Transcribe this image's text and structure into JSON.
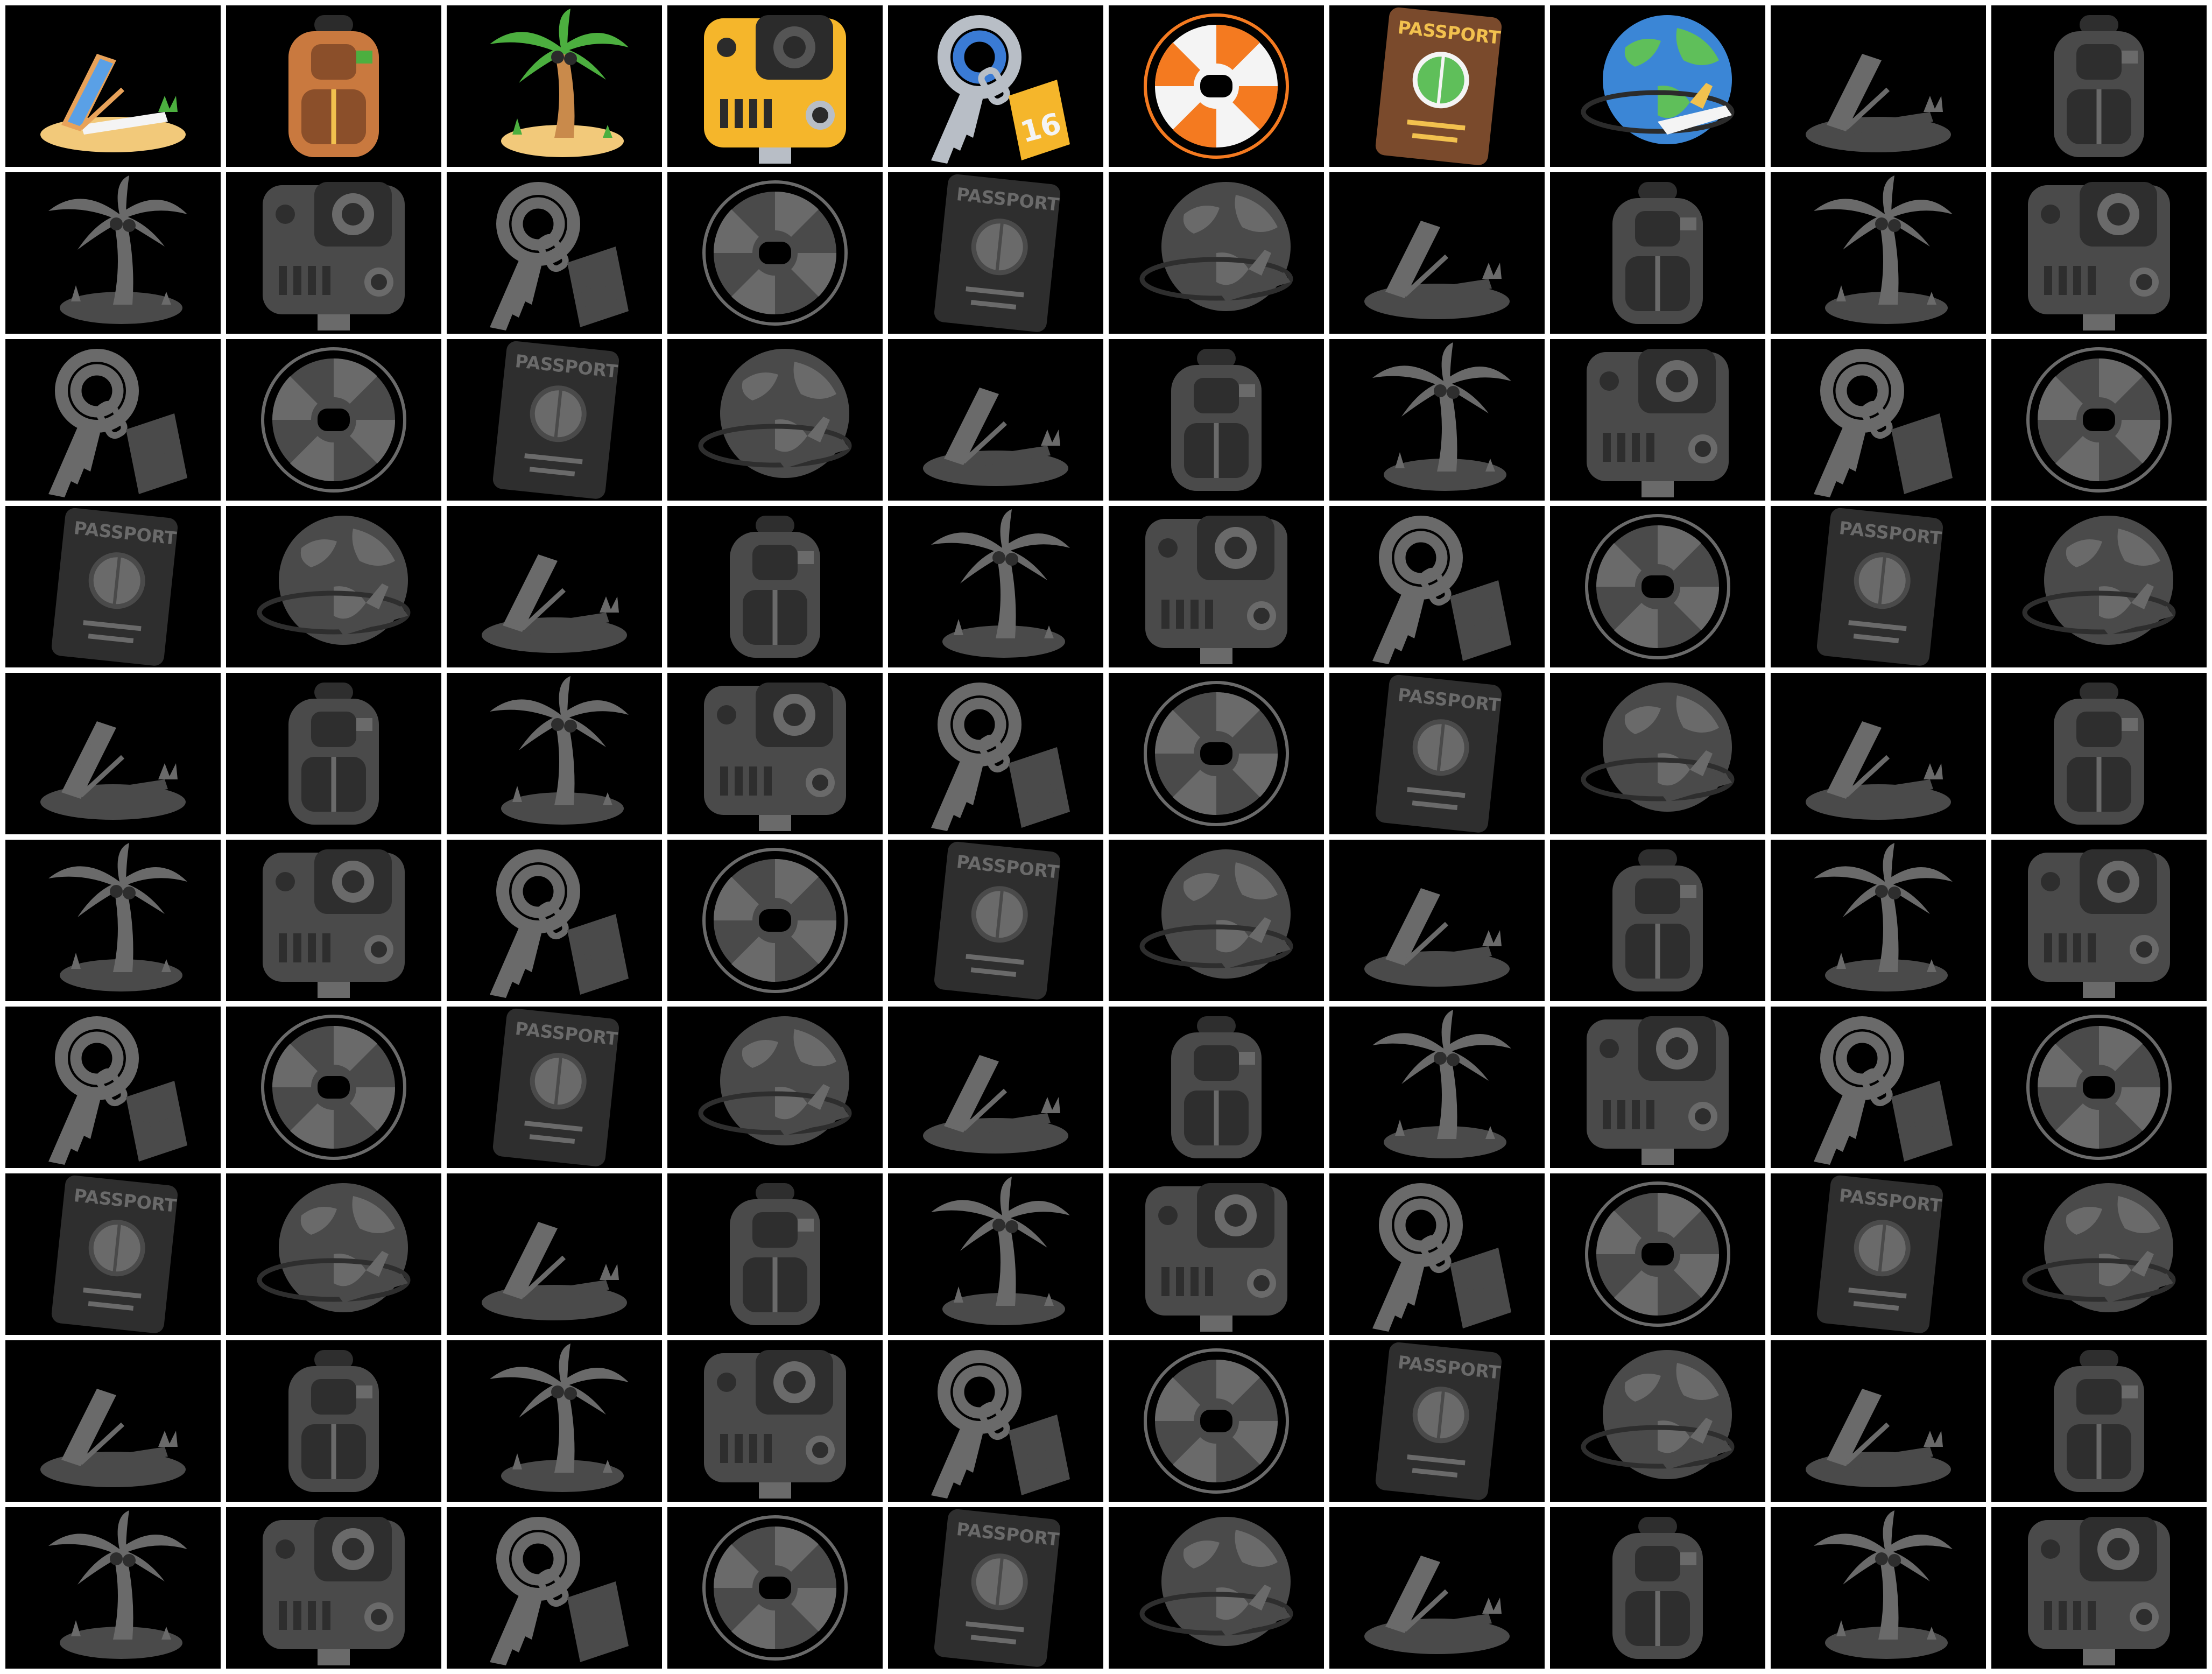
{
  "grid": {
    "columns": 10,
    "rows": 10
  },
  "tiles_sequence": [
    "beach-chair",
    "backpack",
    "palm-tree",
    "action-camera",
    "key-tag",
    "life-ring",
    "passport",
    "globe-plane"
  ],
  "first_row_color_count": 8,
  "colors": {
    "background": "#000000",
    "gap": "#ffffff",
    "monochrome_light": "#6a6a6a",
    "monochrome_mid": "#4a4a4a",
    "monochrome_dark": "#2e2e2e",
    "sand": "#f2c97a",
    "palm_green": "#4caf3f",
    "trunk": "#c98a4b",
    "stripe_blue": "#5aa0e6",
    "camera_yellow": "#f5b62b",
    "passport_brown": "#7a4a2c",
    "passport_gold": "#f2c14e",
    "ring_orange": "#f47a20",
    "globe_blue": "#3b86d6",
    "globe_green": "#5fbf5a",
    "metal": "#b8bec6"
  },
  "labels": {
    "passport": "PASSPORT",
    "key_tag": "16"
  }
}
